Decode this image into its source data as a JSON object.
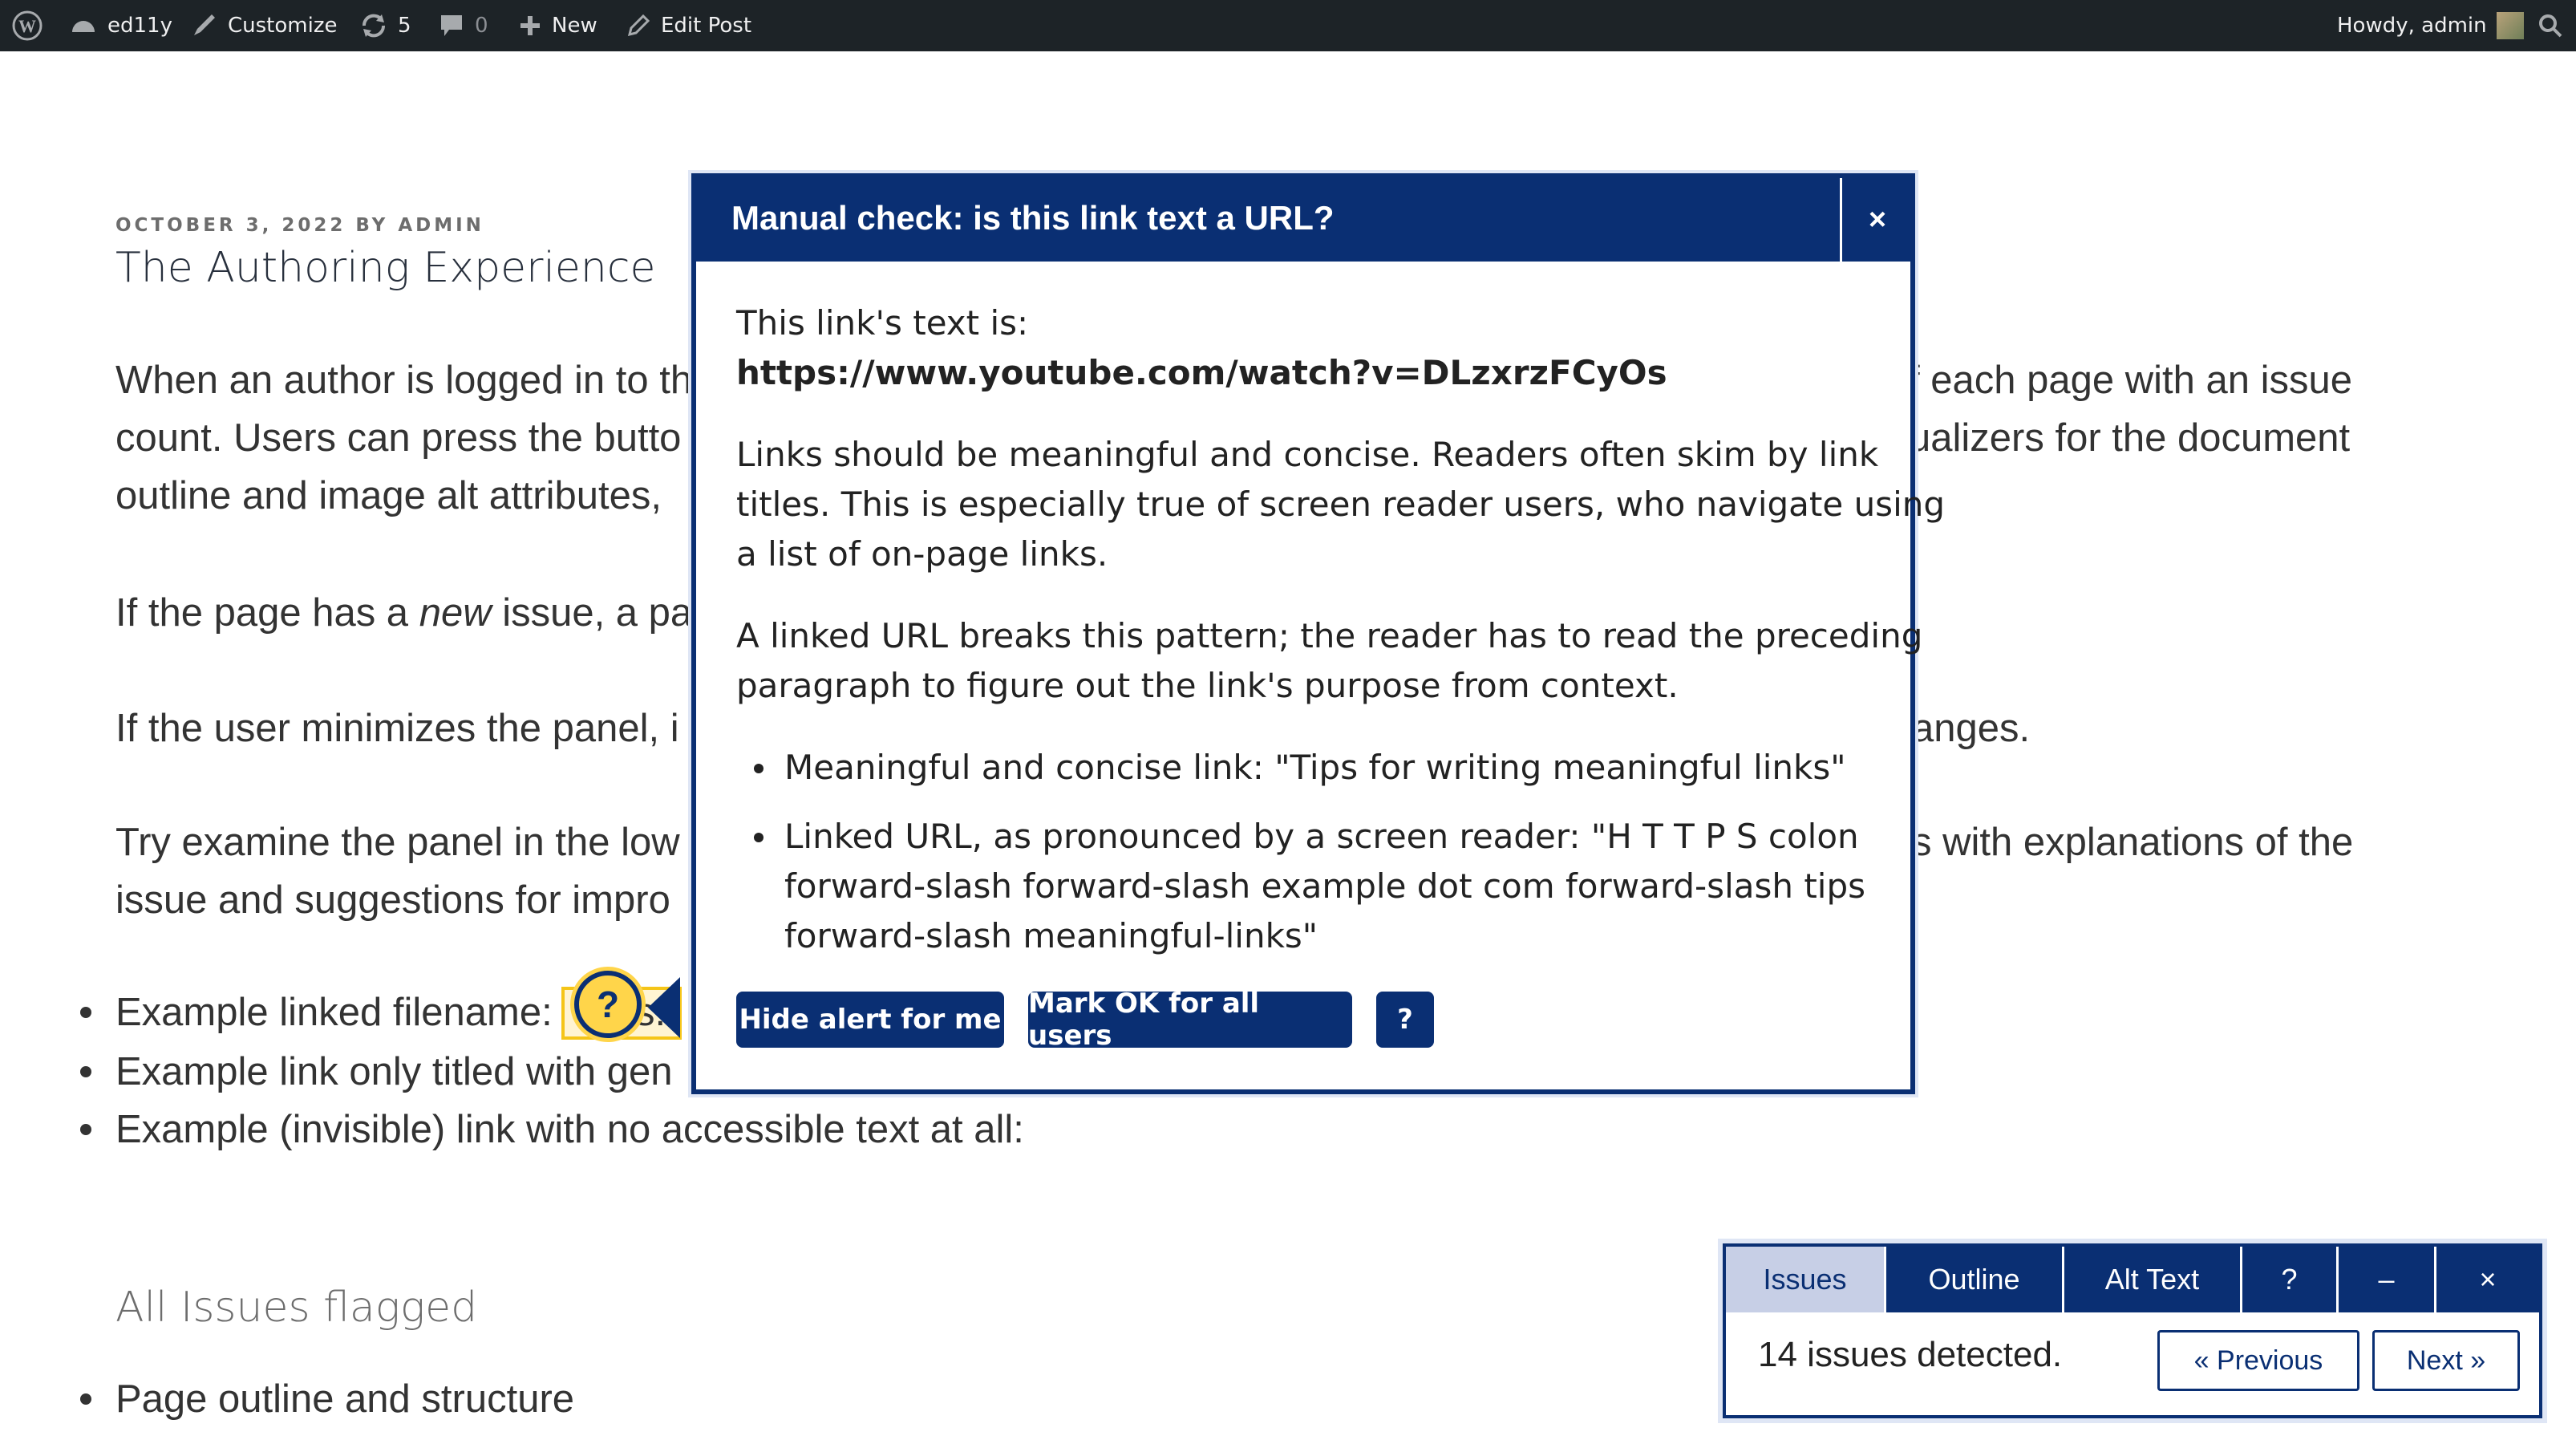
{
  "adminbar": {
    "site_name": "ed11y",
    "customize": "Customize",
    "updates_count": "5",
    "comments_count": "0",
    "new_label": "New",
    "edit_post": "Edit Post",
    "howdy": "Howdy, admin"
  },
  "post": {
    "meta": "OCTOBER 3, 2022 BY ADMIN",
    "title": "The Authoring Experience",
    "p1": [
      "When an author is logged in to th",
      "count. Users can press the butto",
      "outline and image alt attributes,"
    ],
    "p1_right": [
      "f each page with an issue",
      "ualizers for the document"
    ],
    "p2_pre": "If the page has a ",
    "p2_em": "new",
    "p2_post": " issue, a pa",
    "p3": "If the user minimizes the panel, i",
    "p3_right": "anges.",
    "p4": [
      "Try examine the panel in the low",
      "issue and suggestions for impro"
    ],
    "p4_right": "s with explanations of the",
    "bullets": [
      "Example linked filename:",
      "Example link only titled with gen",
      "Example (invisible) link with no accessible text at all:"
    ],
    "link_fragment": "s.",
    "subheading": "All Issues flagged",
    "bullet2": "Page outline and structure"
  },
  "tooltip_button": "?",
  "dialog": {
    "title": "Manual check: is this link text a URL?",
    "close": "×",
    "intro": "This link's text is:",
    "url": "https://www.youtube.com/watch?v=DLzxrzFCyOs",
    "para1": [
      "Links should be meaningful and concise. Readers often skim by link",
      "titles. This is especially true of screen reader users, who navigate using",
      "a list of on-page links."
    ],
    "para2": [
      "A linked URL breaks this pattern; the reader has to read the preceding",
      "paragraph to figure out the link's purpose from context."
    ],
    "li1": "Meaningful and concise link: \"Tips for writing meaningful links\"",
    "li2": [
      "Linked URL, as pronounced by a screen reader: \"H T T P S colon",
      "forward-slash forward-slash example dot com forward-slash tips",
      "forward-slash meaningful-links\""
    ],
    "btn_hide": "Hide alert for me",
    "btn_ok": "Mark OK for all users",
    "btn_help": "?"
  },
  "panel": {
    "tabs": [
      "Issues",
      "Outline",
      "Alt Text",
      "?",
      "–",
      "×"
    ],
    "count": "14 issues detected.",
    "prev": "« Previous",
    "next": "Next »"
  },
  "colors": {
    "accent": "#0a2f73",
    "highlight": "#ffd54a",
    "adminbar": "#1d2327"
  }
}
